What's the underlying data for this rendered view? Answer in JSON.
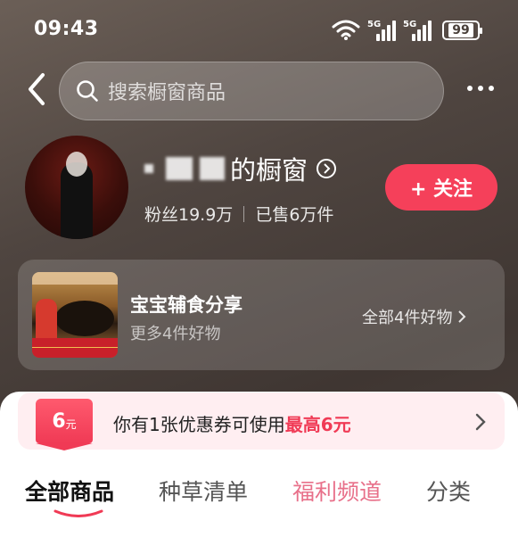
{
  "status_bar": {
    "time": "09:43",
    "network_1": "5G",
    "network_2": "5G",
    "battery": "99"
  },
  "search": {
    "placeholder": "搜索橱窗商品"
  },
  "profile": {
    "name_suffix": "的橱窗",
    "fans": "粉丝19.9万",
    "sold": "已售6万件",
    "follow_label": "+ 关注"
  },
  "collection": {
    "title": "宝宝辅食分享",
    "subtitle": "更多4件好物",
    "link": "全部4件好物"
  },
  "coupon": {
    "amount": "6",
    "unit": "元",
    "text_prefix": "你有1张优惠券可使用",
    "text_highlight": "最高6元"
  },
  "tabs": [
    {
      "label": "全部商品"
    },
    {
      "label": "种草清单"
    },
    {
      "label": "福利频道"
    },
    {
      "label": "分类"
    }
  ],
  "colors": {
    "accent": "#f5405a",
    "coupon_bg": "#ffeef1",
    "highlight_tab": "#e8708a"
  },
  "icons": [
    "wifi-icon",
    "signal-icon",
    "battery-icon",
    "back-icon",
    "search-icon",
    "more-icon",
    "chevron-right-icon"
  ]
}
